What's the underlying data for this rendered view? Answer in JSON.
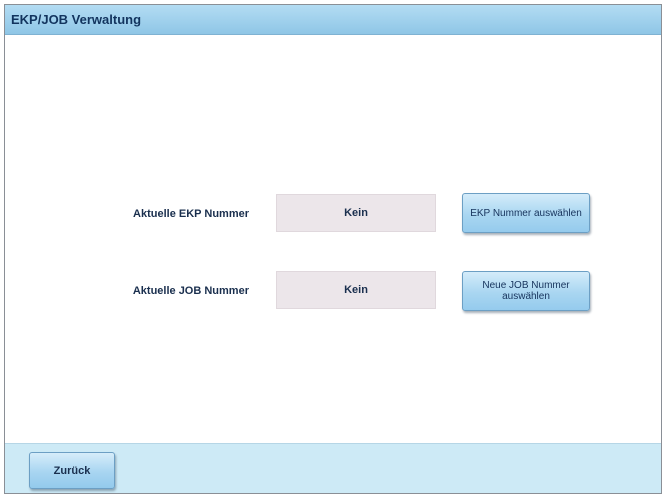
{
  "window": {
    "title": "EKP/JOB Verwaltung"
  },
  "ekp": {
    "label": "Aktuelle EKP Nummer",
    "value": "Kein",
    "button_label": "EKP Nummer auswählen"
  },
  "job": {
    "label": "Aktuelle JOB Nummer",
    "value": "Kein",
    "button_label": "Neue JOB Nummer auswählen"
  },
  "footer": {
    "back_label": "Zurück"
  }
}
